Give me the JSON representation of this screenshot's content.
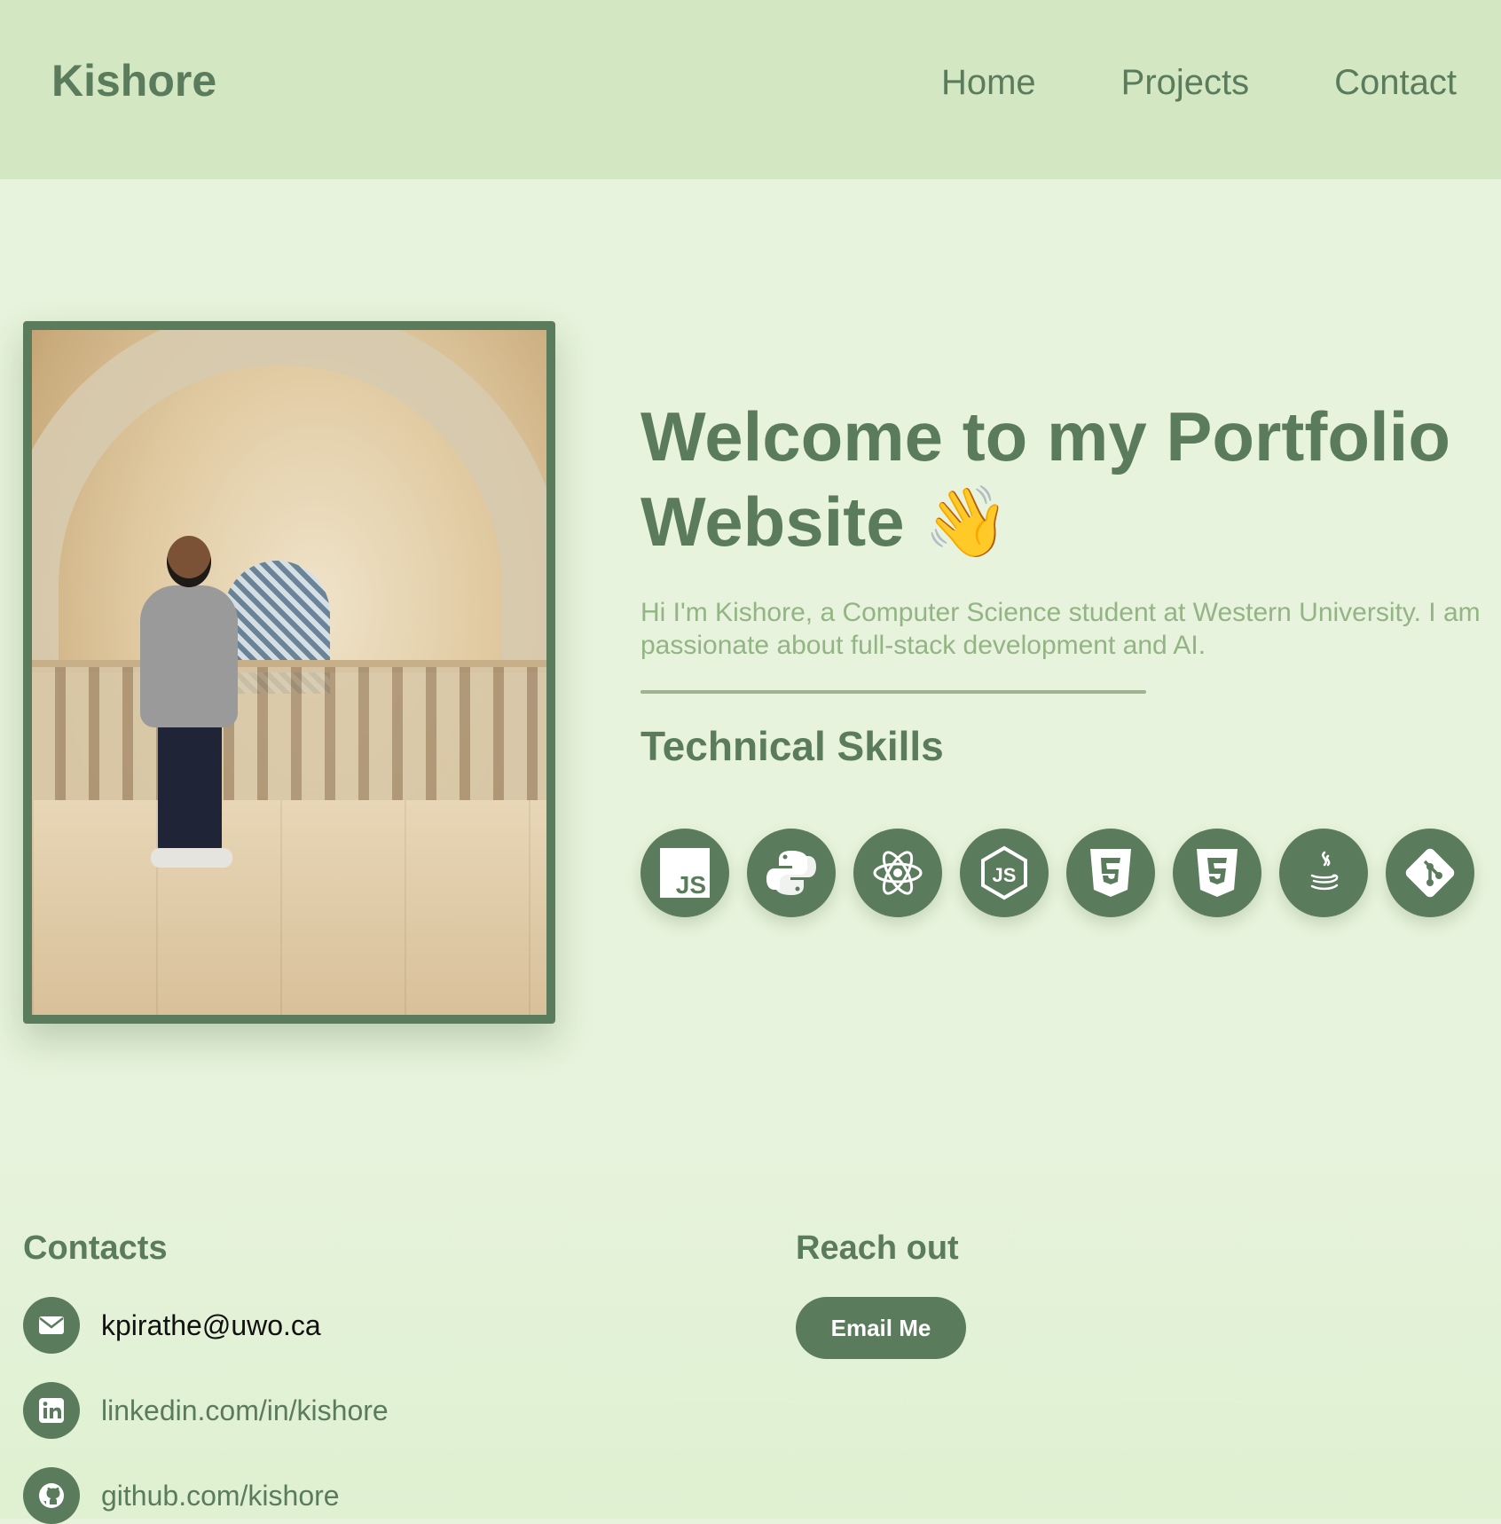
{
  "header": {
    "logo": "Kishore",
    "nav": [
      {
        "label": "Home"
      },
      {
        "label": "Projects"
      },
      {
        "label": "Contact"
      }
    ]
  },
  "hero": {
    "title": "Welcome to my Portfolio Website 👋",
    "subtitle": "Hi I'm Kishore, a Computer Science student at Western University. I am passionate about full-stack development and AI.",
    "skills_title": "Technical Skills",
    "skills": [
      {
        "icon": "javascript-icon"
      },
      {
        "icon": "python-icon"
      },
      {
        "icon": "react-icon"
      },
      {
        "icon": "nodejs-icon"
      },
      {
        "icon": "html5-icon"
      },
      {
        "icon": "css3-icon"
      },
      {
        "icon": "java-icon"
      },
      {
        "icon": "git-icon"
      }
    ]
  },
  "footer": {
    "contacts_title": "Contacts",
    "contacts": [
      {
        "icon": "envelope-icon",
        "text": "kpirathe@uwo.ca"
      },
      {
        "icon": "linkedin-icon",
        "text": "linkedin.com/in/kishore"
      },
      {
        "icon": "github-icon",
        "text": "github.com/kishore"
      }
    ],
    "reach_title": "Reach out",
    "email_button": "Email Me"
  },
  "colors": {
    "primary": "#5b7b5d",
    "header_bg": "#d2e7c2",
    "page_bg": "#e7f3dc",
    "subtitle": "#93b484"
  }
}
